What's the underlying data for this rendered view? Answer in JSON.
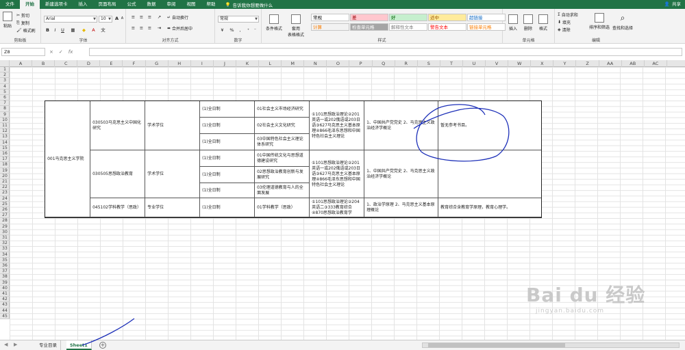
{
  "tabs": [
    "文件",
    "开始",
    "新建选项卡",
    "插入",
    "页面布局",
    "公式",
    "数据",
    "审阅",
    "视图",
    "帮助"
  ],
  "active_tab": "开始",
  "tell_me": "告诉我你想要做什么",
  "share": "共享",
  "ribbon": {
    "clipboard": {
      "label": "剪贴板",
      "paste": "粘贴",
      "cut": "剪切",
      "copy": "复制",
      "format_painter": "格式刷"
    },
    "font": {
      "label": "字体",
      "name": "Arial",
      "size": "10",
      "bold": "B",
      "italic": "I",
      "underline": "U",
      "grow": "A",
      "shrink": "A"
    },
    "alignment": {
      "label": "对齐方式",
      "wrap": "自动换行",
      "merge": "合并后居中"
    },
    "number": {
      "label": "数字",
      "format": "常规",
      "percent": "%",
      "comma": ","
    },
    "styles": {
      "label": "样式",
      "conditional": "条件格式",
      "table": "套用\n表格格式",
      "cells": [
        {
          "text": "常规",
          "bg": "#ffffff",
          "fg": "#000000"
        },
        {
          "text": "差",
          "bg": "#ffc7ce",
          "fg": "#9c0006"
        },
        {
          "text": "好",
          "bg": "#c6efce",
          "fg": "#006100"
        },
        {
          "text": "适中",
          "bg": "#ffeb9c",
          "fg": "#9c5700"
        },
        {
          "text": "超链接",
          "bg": "#ffffff",
          "fg": "#0563c1"
        },
        {
          "text": "计算",
          "bg": "#f2f2f2",
          "fg": "#fa7d00"
        },
        {
          "text": "检查单元格",
          "bg": "#a5a5a5",
          "fg": "#ffffff"
        },
        {
          "text": "解释性文本",
          "bg": "#ffffff",
          "fg": "#7f7f7f"
        },
        {
          "text": "警告文本",
          "bg": "#ffffff",
          "fg": "#ff0000"
        },
        {
          "text": "链接单元格",
          "bg": "#ffffff",
          "fg": "#fa7d00"
        }
      ]
    },
    "cells": {
      "label": "单元格",
      "insert": "插入",
      "delete": "删除",
      "format": "格式"
    },
    "editing": {
      "label": "编辑",
      "autosum": "自动求和",
      "fill": "填充",
      "clear": "清除",
      "sort": "排序和筛选",
      "find": "查找和选择"
    }
  },
  "formula_bar": {
    "name_box": "Z8",
    "fx": "fx",
    "cancel": "×",
    "enter": "✓"
  },
  "columns": [
    "A",
    "B",
    "C",
    "D",
    "E",
    "F",
    "G",
    "H",
    "I",
    "J",
    "K",
    "L",
    "M",
    "N",
    "O",
    "P",
    "Q",
    "R",
    "S",
    "T",
    "U",
    "V",
    "W",
    "X",
    "Y",
    "Z",
    "AA",
    "AB",
    "AC"
  ],
  "rows": [
    "1",
    "2",
    "3",
    "4",
    "5",
    "6",
    "7",
    "8",
    "9",
    "10",
    "11",
    "12",
    "13",
    "14",
    "15",
    "16",
    "17",
    "18",
    "19",
    "20",
    "21",
    "22",
    "23",
    "24",
    "25",
    "26",
    "27",
    "28",
    "29",
    "30",
    "31",
    "32",
    "33",
    "34",
    "35",
    "36",
    "37",
    "38",
    "39",
    "40",
    "41",
    "42",
    "43",
    "44",
    "45"
  ],
  "table": {
    "college": "001马克思主义学院",
    "majors": [
      {
        "name": "030503马克思主义中国化研究",
        "degree": "学术学位"
      },
      {
        "name": "030505思想政治教育",
        "degree": "学术学位"
      },
      {
        "name": "045102学科教学（思政）",
        "degree": "专业学位"
      }
    ],
    "modes": [
      "(1)全日制",
      "(1)全日制",
      "(1)全日制",
      "(1)全日制",
      "(1)全日制",
      "(1)全日制",
      "(1)全日制"
    ],
    "directions": [
      "01社会主义市场经济研究",
      "02社会主义文化研究",
      "03中国特色社会主义理论体系研究",
      "01中国传统文化与思想道德建设研究",
      "02思想政治教育创新与发展研究",
      "03伦理道德教育与人的全面发展",
      "01学科教学（思政）"
    ],
    "exams": [
      "①101思想政治理论②201英语一或202俄语或203日语③627马克思主义基本原理④866毛泽东思想和中国特色社会主义理论",
      "①101思想政治理论②201英语一或202俄语或203日语③627马克思主义基本原理④866毛泽东思想和中国特色社会主义理论",
      "①101思想政治理论②204英语二③333教育综合④870思想政治教育学"
    ],
    "subjects": [
      "1、中国共产党党史 2、马克思主义政治经济学概论",
      "1、中国共产党党史 2、马克思主义政治经济学概论",
      "1、政治学原理 2、马克思主义基本原理概论"
    ],
    "refs": [
      "暂无参考书目。",
      "",
      "教育综合含教育学原理，教育心理学。"
    ]
  },
  "sheets": [
    "专业目录",
    "Sheet1"
  ],
  "active_sheet": "Sheet1",
  "watermark": {
    "brand": "Bai du 经验",
    "url": "jingyan.baidu.com"
  }
}
